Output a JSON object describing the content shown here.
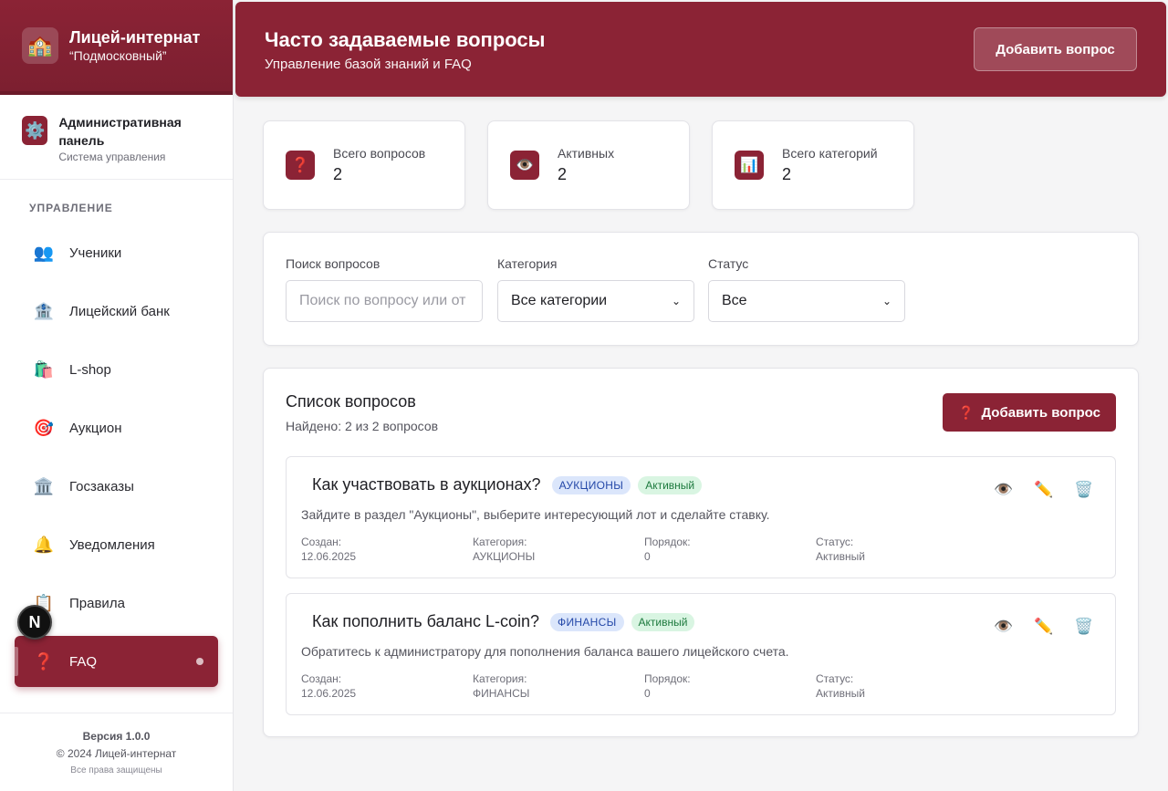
{
  "sidebar": {
    "brand_title": "Лицей-интернат",
    "brand_subtitle": "“Подмосковный”",
    "brand_icon": "school-icon",
    "admin_title": "Административная панель",
    "admin_subtitle": "Система управления",
    "section_label": "УПРАВЛЕНИЕ",
    "items": [
      {
        "label": "Ученики",
        "icon": "👥"
      },
      {
        "label": "Лицейский банк",
        "icon": "🏦"
      },
      {
        "label": "L-shop",
        "icon": "🛍️"
      },
      {
        "label": "Аукцион",
        "icon": "🎯"
      },
      {
        "label": "Госзаказы",
        "icon": "🏛️"
      },
      {
        "label": "Уведомления",
        "icon": "🔔"
      },
      {
        "label": "Правила",
        "icon": "📋"
      },
      {
        "label": "FAQ",
        "icon": "❓"
      }
    ],
    "footer_version": "Версия 1.0.0",
    "footer_copyright": "© 2024 Лицей-интернат",
    "footer_rights": "Все права защищены"
  },
  "header": {
    "title": "Часто задаваемые вопросы",
    "subtitle": "Управление базой знаний и FAQ",
    "button": "Добавить вопрос"
  },
  "stats": [
    {
      "label": "Всего вопросов",
      "value": "2",
      "icon": "❓"
    },
    {
      "label": "Активных",
      "value": "2",
      "icon": "👁️"
    },
    {
      "label": "Всего категорий",
      "value": "2",
      "icon": "📊"
    }
  ],
  "filters": {
    "search_label": "Поиск вопросов",
    "search_placeholder": "Поиск по вопросу или от",
    "category_label": "Категория",
    "category_value": "Все категории",
    "status_label": "Статус",
    "status_value": "Все"
  },
  "list": {
    "title": "Список вопросов",
    "found": "Найдено: 2 из 2 вопросов",
    "add_button": "Добавить вопрос",
    "add_icon": "❓",
    "meta_labels": {
      "created": "Создан:",
      "category": "Категория:",
      "order": "Порядок:",
      "status": "Статус:"
    },
    "questions": [
      {
        "question": "Как участвовать в аукционах?",
        "category": "АУКЦИОНЫ",
        "status": "Активный",
        "answer": "Зайдите в раздел \"Аукционы\", выберите интересующий лот и сделайте ставку.",
        "created": "12.06.2025",
        "order": "0"
      },
      {
        "question": "Как пополнить баланс L-coin?",
        "category": "ФИНАНСЫ",
        "status": "Активный",
        "answer": "Обратитесь к администратору для пополнения баланса вашего лицейского счета.",
        "created": "12.06.2025",
        "order": "0"
      }
    ]
  },
  "overlay": {
    "fab_letter": "N"
  }
}
